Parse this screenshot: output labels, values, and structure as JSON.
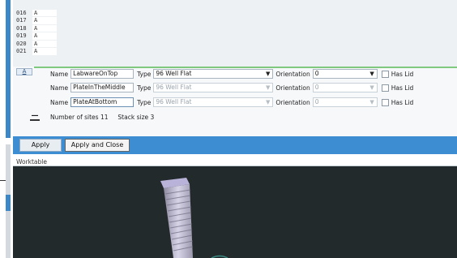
{
  "list_rows": [
    {
      "num": "016",
      "value": "A"
    },
    {
      "num": "017",
      "value": "A"
    },
    {
      "num": "018",
      "value": "A"
    },
    {
      "num": "019",
      "value": "A"
    },
    {
      "num": "020",
      "value": "A"
    },
    {
      "num": "021",
      "value": "A"
    }
  ],
  "stack": {
    "tab_label": "A",
    "sites": [
      {
        "name_label": "Name",
        "name": "LabwareOnTop",
        "type_label": "Type",
        "type": "96 Well Flat",
        "orientation_label": "Orientation",
        "orientation": "0",
        "has_lid_label": "Has Lid",
        "enabled": true
      },
      {
        "name_label": "Name",
        "name": "PlateInTheMiddle",
        "type_label": "Type",
        "type": "96 Well Flat",
        "orientation_label": "Orientation",
        "orientation": "0",
        "has_lid_label": "Has Lid",
        "enabled": false
      },
      {
        "name_label": "Name",
        "name": "PlateAtBottom",
        "type_label": "Type",
        "type": "96 Well Flat",
        "orientation_label": "Orientation",
        "orientation": "0",
        "has_lid_label": "Has Lid",
        "enabled": false
      }
    ],
    "minus_label": "—",
    "sites_summary": "Number of sites 11     Stack size 3"
  },
  "actions": {
    "apply": "Apply",
    "apply_close": "Apply and Close"
  },
  "worktable": {
    "label": "Worktable"
  },
  "colors": {
    "accent": "#3d8dd3",
    "viewport_bg": "#222a2c",
    "green_highlight": "#7fc97f"
  }
}
